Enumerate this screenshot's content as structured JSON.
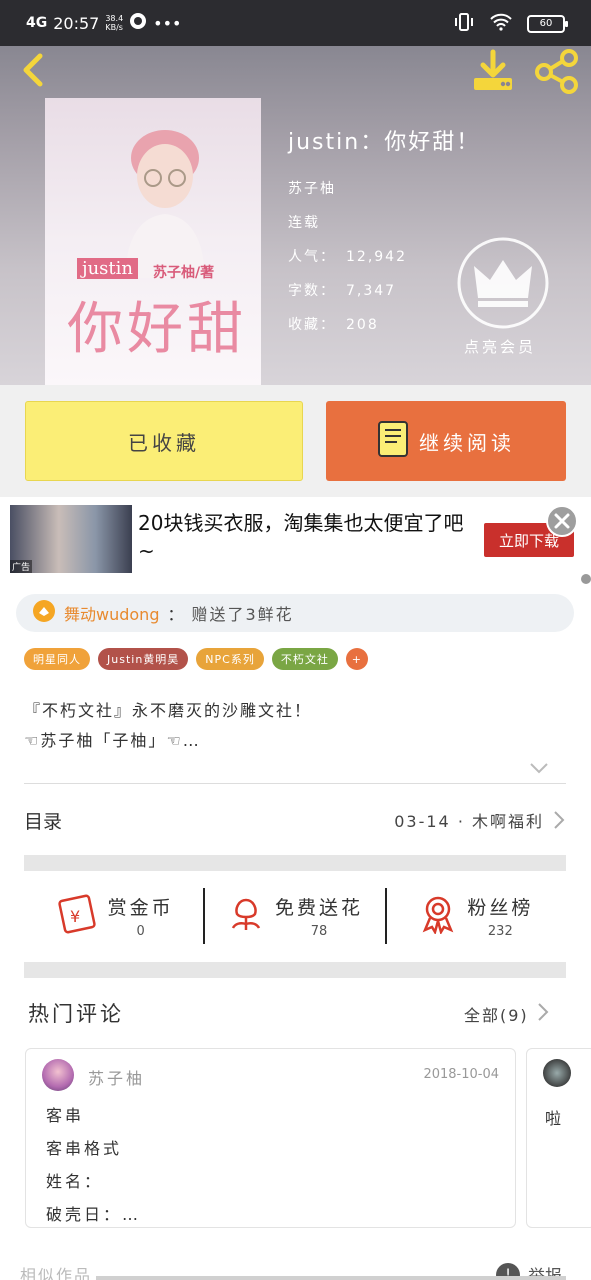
{
  "status_bar": {
    "network": "4G",
    "time": "20:57",
    "speed_value": "38.4",
    "speed_unit": "KB/s",
    "battery": "60"
  },
  "header": {
    "icons": [
      "back-icon",
      "download-icon",
      "share-icon"
    ],
    "cover": {
      "tag": "justin",
      "author": "苏子柚/著",
      "title": "你好甜"
    },
    "book_title": "justin：你好甜！",
    "author": "苏子柚",
    "status": "连载",
    "stats": [
      {
        "label": "人气：",
        "value": "12,942"
      },
      {
        "label": "字数：",
        "value": "7,347"
      },
      {
        "label": "收藏：",
        "value": "208"
      }
    ],
    "vip_label": "点亮会员"
  },
  "actions": {
    "favorite_label": "已收藏",
    "continue_label": "继续阅读"
  },
  "ad": {
    "corner_tag": "广告",
    "text": "20块钱买衣服，淘集集也太便宜了吧~",
    "button": "立即下载"
  },
  "gift": {
    "who": "舞动wudong",
    "separator": "：",
    "what": "赠送了3鲜花"
  },
  "tags": [
    {
      "label": "明星同人",
      "color": "#f0a23a"
    },
    {
      "label": "Justin黄明昊",
      "color": "#b2524a"
    },
    {
      "label": "NPC系列",
      "color": "#e8a43a"
    },
    {
      "label": "不朽文社",
      "color": "#7aa644"
    },
    {
      "label": "+",
      "color": "#e8703f"
    }
  ],
  "description": {
    "line1": "『不朽文社』永不磨灭的沙雕文社！",
    "line2": "☜苏子柚「子柚」☜…"
  },
  "toc": {
    "label": "目录",
    "latest": "03-14 · 木啊福利"
  },
  "stats": [
    {
      "label": "赏金币",
      "value": "0"
    },
    {
      "label": "免费送花",
      "value": "78"
    },
    {
      "label": "粉丝榜",
      "value": "232"
    }
  ],
  "comments": {
    "title": "热门评论",
    "all": "全部(9)",
    "first": {
      "user": "苏子柚",
      "date": "2018-10-04",
      "lines": [
        "客串",
        "客串格式",
        "姓名：",
        "破壳日：…"
      ]
    },
    "second_peek": "啦"
  },
  "footer": {
    "similar": "相似作品",
    "report": "举报"
  },
  "colors": {
    "favorite_bg": "#fbee76",
    "continue_bg": "#e8703f",
    "ad_button": "#c9302c",
    "gift_name": "#e88a2f"
  }
}
